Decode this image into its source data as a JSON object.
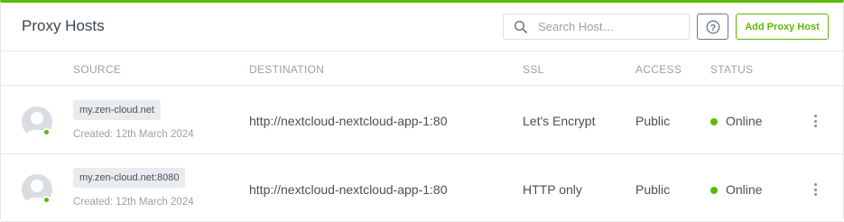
{
  "header": {
    "title": "Proxy Hosts",
    "search_placeholder": "Search Host…",
    "help_label": "?",
    "add_label": "Add Proxy Host"
  },
  "columns": {
    "source": "SOURCE",
    "destination": "DESTINATION",
    "ssl": "SSL",
    "access": "ACCESS",
    "status": "STATUS"
  },
  "rows": [
    {
      "domain": "my.zen-cloud.net",
      "created": "Created: 12th March 2024",
      "destination": "http://nextcloud-nextcloud-app-1:80",
      "ssl": "Let's Encrypt",
      "access": "Public",
      "status": "Online"
    },
    {
      "domain": "my.zen-cloud.net:8080",
      "created": "Created: 12th March 2024",
      "destination": "http://nextcloud-nextcloud-app-1:80",
      "ssl": "HTTP only",
      "access": "Public",
      "status": "Online"
    }
  ],
  "colors": {
    "accent": "#5eba00",
    "online": "#5eba00",
    "muted_text": "#9aa0ac",
    "border": "#e6e8ec"
  },
  "icons": {
    "search": "search-icon",
    "help": "question-circle-icon",
    "avatar": "user-avatar-icon",
    "menu": "more-vertical-icon"
  }
}
